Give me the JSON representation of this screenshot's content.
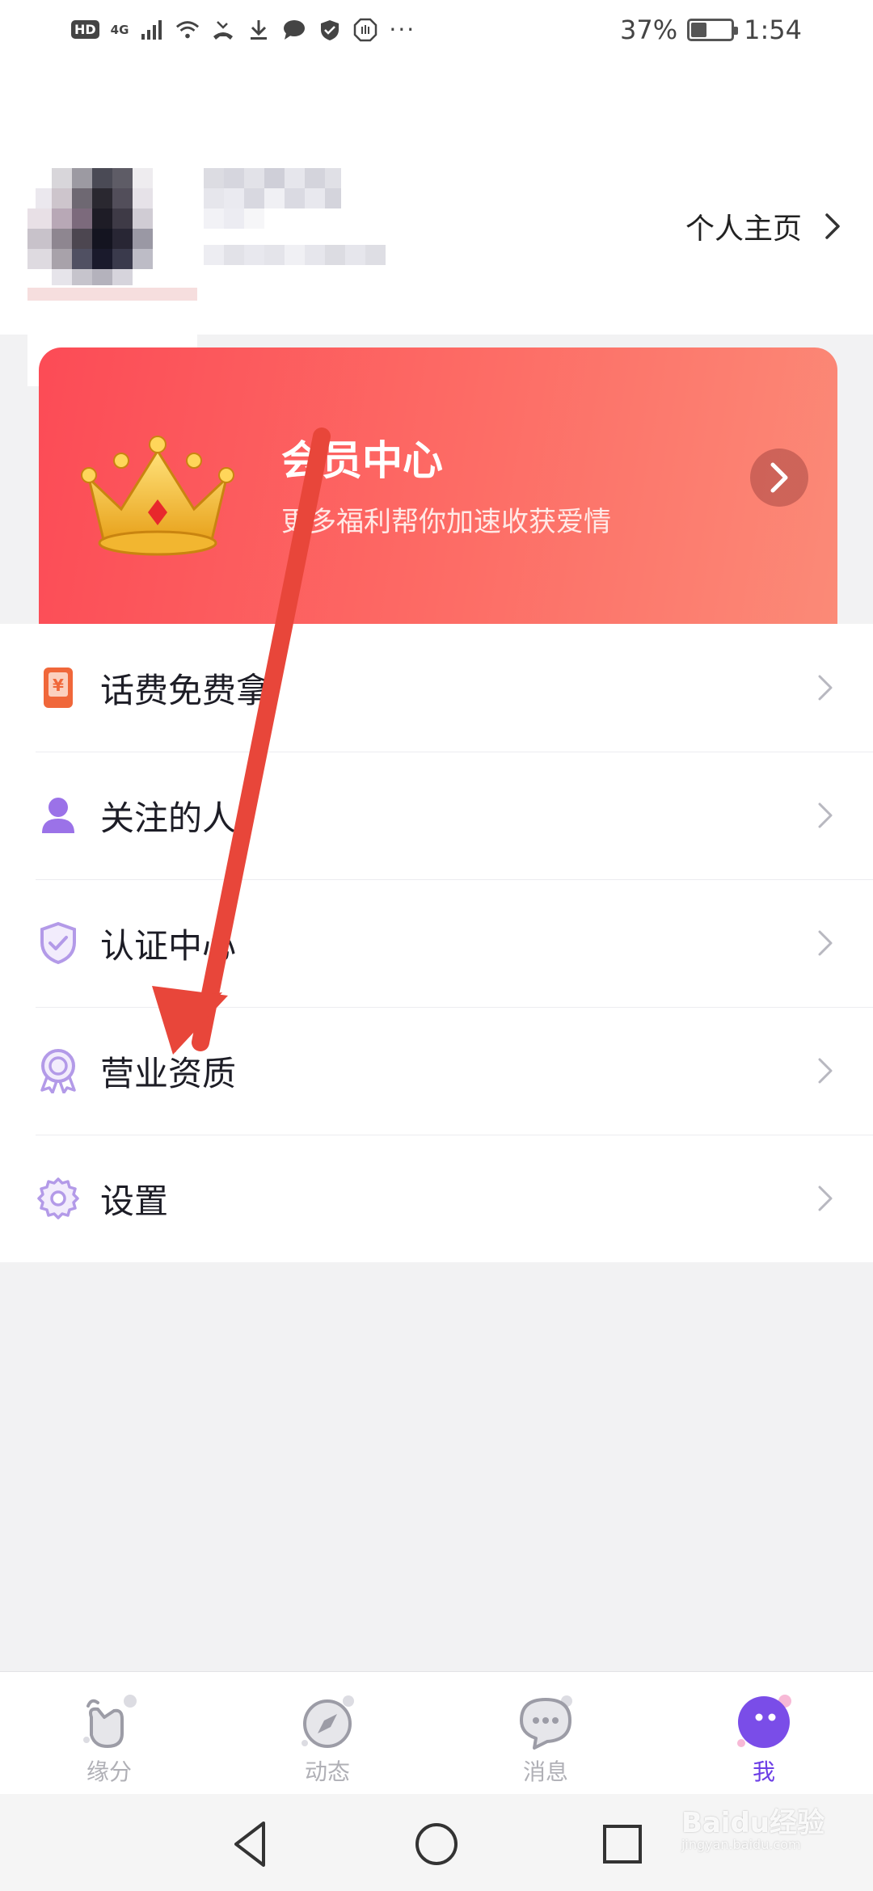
{
  "status_bar": {
    "hd": "HD",
    "network": "4G",
    "battery": "37%",
    "battery_level": 0.37,
    "time": "1:54"
  },
  "header": {
    "profile_link": "个人主页"
  },
  "vip": {
    "title": "会员中心",
    "subtitle": "更多福利帮你加速收获爱情"
  },
  "menu": [
    {
      "label": "话费免费拿",
      "icon": "phone-credit-icon"
    },
    {
      "label": "关注的人",
      "icon": "person-icon"
    },
    {
      "label": "认证中心",
      "icon": "shield-check-icon"
    },
    {
      "label": "营业资质",
      "icon": "badge-icon"
    },
    {
      "label": "设置",
      "icon": "gear-icon"
    }
  ],
  "tabs": [
    {
      "label": "缘分",
      "icon": "hand-heart-icon"
    },
    {
      "label": "动态",
      "icon": "compass-icon"
    },
    {
      "label": "消息",
      "icon": "chat-bubble-icon"
    },
    {
      "label": "我",
      "icon": "face-icon",
      "active": true
    }
  ],
  "watermark": {
    "brand": "Baidu经验",
    "url": "jingyan.baidu.com"
  },
  "colors": {
    "accent": "#6c3ee6",
    "vip_start": "#fc4b56",
    "vip_end": "#fb8a77",
    "annotation": "#e8463a"
  }
}
